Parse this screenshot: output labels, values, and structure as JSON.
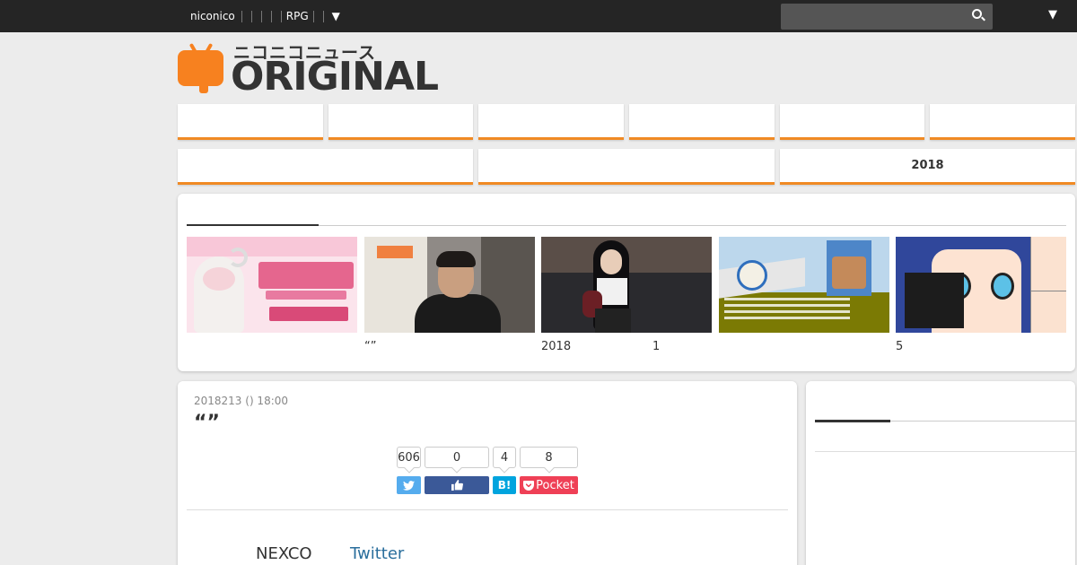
{
  "topbar": {
    "brand": "niconico",
    "rpg": "RPG",
    "dropdown_glyph": "▼",
    "search_icon": "search-icon",
    "menu_glyph": "▼"
  },
  "logo": {
    "kana": "ニコニコニュース",
    "word": "ORIGINAL",
    "color": "#f7811f"
  },
  "tabs_row1": [
    "",
    "",
    "",
    "",
    "",
    ""
  ],
  "tabs_row2": [
    "",
    "",
    "2018"
  ],
  "ranking": {
    "items": [
      {
        "caption": ""
      },
      {
        "caption": "“”"
      },
      {
        "caption": "2018",
        "caption2": "1"
      },
      {
        "caption": ""
      },
      {
        "caption": "5"
      }
    ]
  },
  "article": {
    "date": "2018213 () 18:00",
    "title": "“”",
    "counts": {
      "twitter": "606",
      "facebook": "0",
      "hatena": "4",
      "pocket": "8"
    },
    "buttons": {
      "hatena": "B!",
      "pocket": "Pocket"
    },
    "body_text": "NEXCO",
    "body_link": "Twitter"
  },
  "colors": {
    "accent": "#f08a24",
    "twitter": "#55acee",
    "facebook": "#3b5998",
    "hatena": "#00a4de",
    "pocket": "#ef4056"
  }
}
